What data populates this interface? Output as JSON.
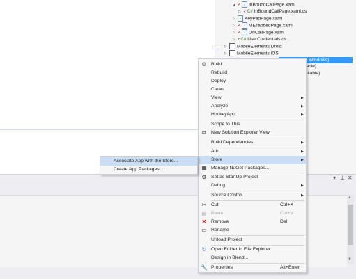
{
  "solution_explorer": {
    "rows": [
      {
        "label": "InBoundCallPage.xaml"
      },
      {
        "label": "InBoundCallPage.xaml.cs"
      },
      {
        "label": "KeyPadPage.xaml"
      },
      {
        "label": "METabbedPage.xaml"
      },
      {
        "label": "OnCallPage.xaml"
      },
      {
        "label": "UserCredentials.cs"
      },
      {
        "label": "MobileElements.Droid"
      },
      {
        "label": "MobileElements.iOS"
      }
    ],
    "selected_fragment": "l Windows)",
    "status_1": "lable)",
    "status_2": "ailable)"
  },
  "context_menu": {
    "items": [
      {
        "label": "Build",
        "icon": "build-icon"
      },
      {
        "label": "Rebuild"
      },
      {
        "label": "Deploy"
      },
      {
        "label": "Clean"
      },
      {
        "label": "View",
        "submenu": true
      },
      {
        "label": "Analyze",
        "submenu": true
      },
      {
        "label": "HockeyApp",
        "submenu": true
      },
      {
        "label": "Scope to This"
      },
      {
        "label": "New Solution Explorer View",
        "icon": "new-view-icon"
      },
      {
        "label": "Build Dependencies",
        "submenu": true
      },
      {
        "label": "Add",
        "submenu": true
      },
      {
        "label": "Store",
        "submenu": true,
        "highlighted": true
      },
      {
        "label": "Manage NuGet Packages...",
        "icon": "nuget-icon"
      },
      {
        "label": "Set as StartUp Project",
        "icon": "gear-icon"
      },
      {
        "label": "Debug",
        "submenu": true
      },
      {
        "label": "Source Control",
        "submenu": true
      },
      {
        "label": "Cut",
        "shortcut": "Ctrl+X",
        "icon": "scissors-icon"
      },
      {
        "label": "Paste",
        "shortcut": "Ctrl+V",
        "disabled": true,
        "icon": "paste-icon"
      },
      {
        "label": "Remove",
        "shortcut": "Del",
        "icon": "remove-icon"
      },
      {
        "label": "Rename",
        "icon": "rename-icon"
      },
      {
        "label": "Unload Project"
      },
      {
        "label": "Open Folder in File Explorer",
        "icon": "refresh-icon"
      },
      {
        "label": "Design in Blend..."
      },
      {
        "label": "Properties",
        "shortcut": "Alt+Enter",
        "icon": "wrench-icon"
      }
    ]
  },
  "store_submenu": {
    "items": [
      {
        "label": "Associate App with the Store...",
        "highlighted": true
      },
      {
        "label": "Create App Packages..."
      }
    ]
  },
  "panel_controls": {
    "dropdown": "▾",
    "pin": "⊥",
    "close": "✕"
  },
  "colors": {
    "highlight": "#c9def5",
    "selection": "#3399ff",
    "menu_bg": "#f6f6f6"
  }
}
